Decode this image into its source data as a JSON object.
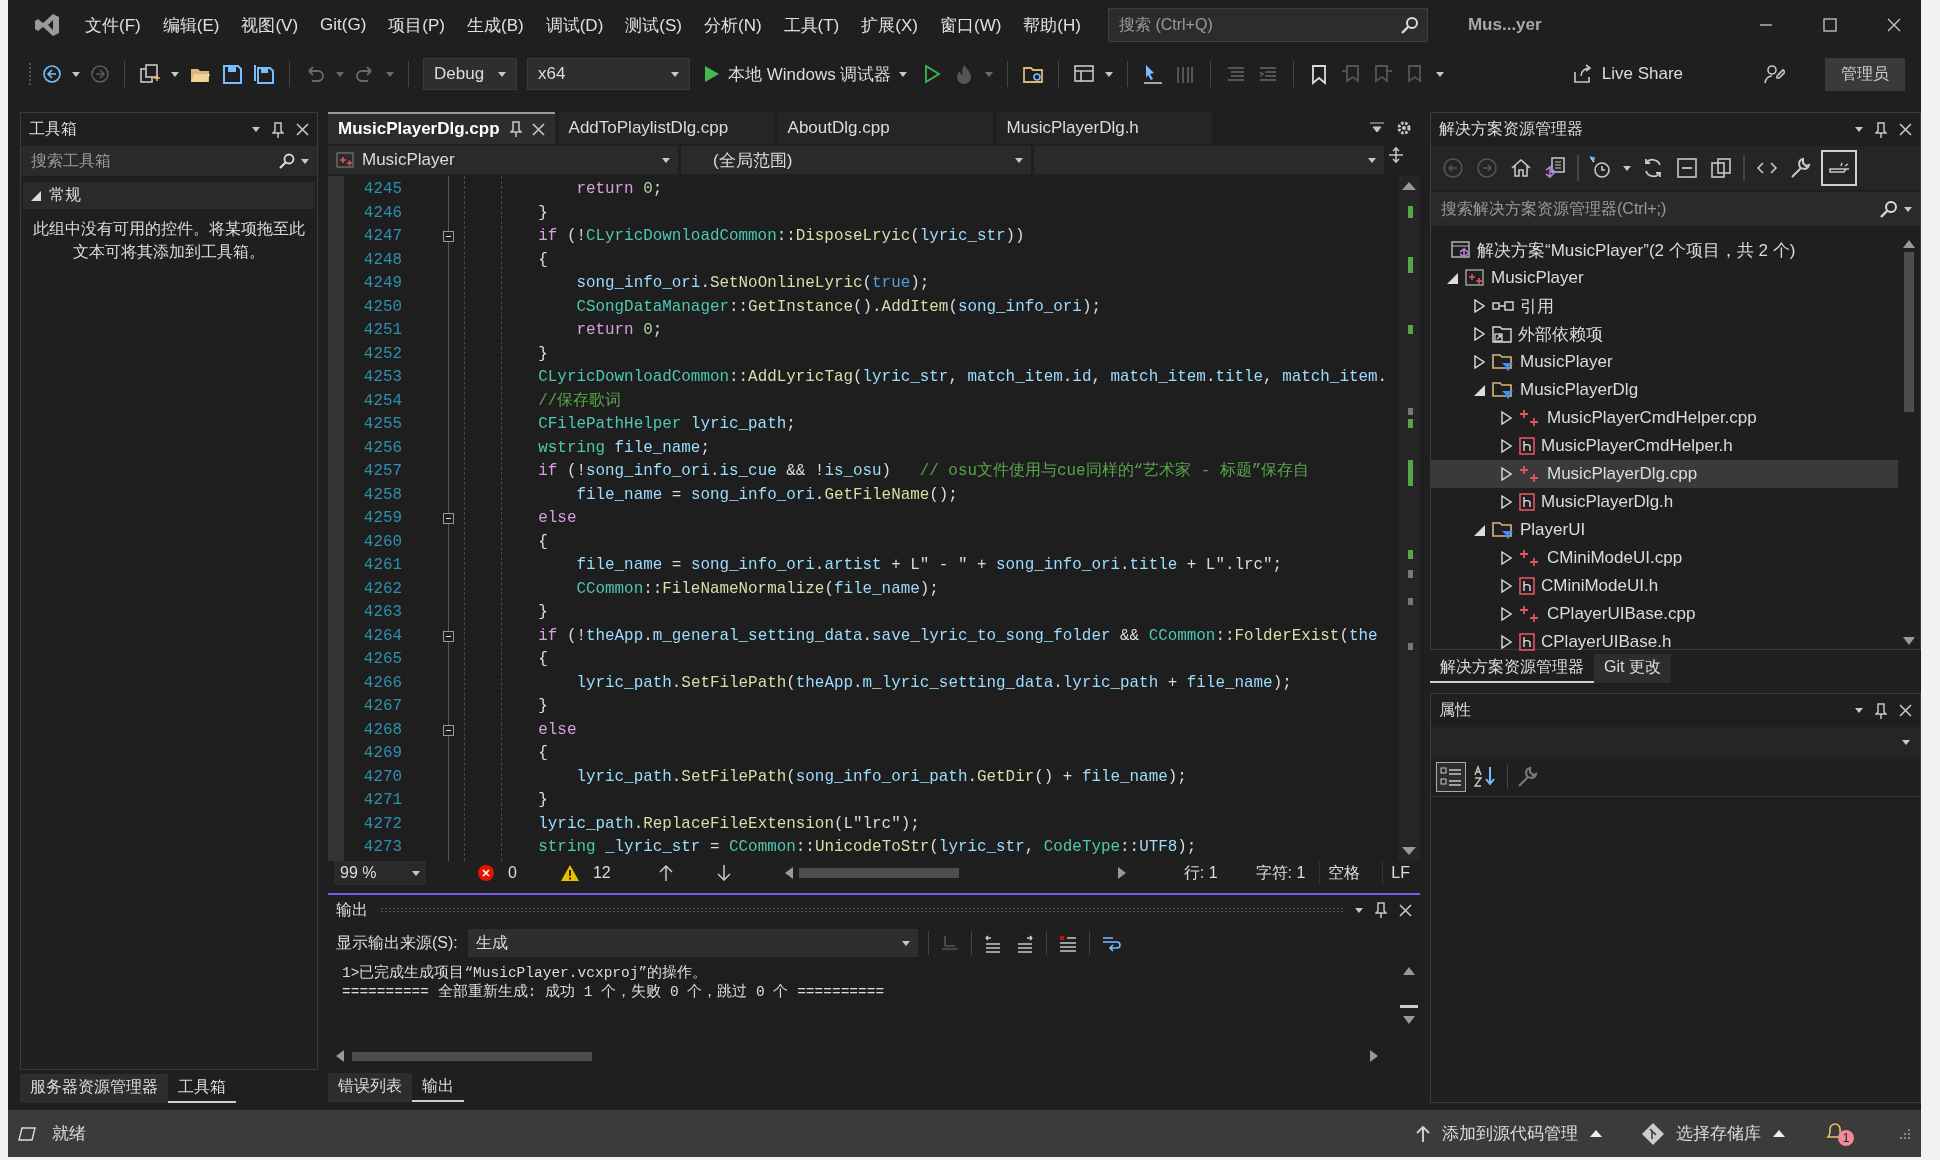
{
  "window": {
    "title": "Mus...yer"
  },
  "menu_bar": {
    "items": [
      "文件(F)",
      "编辑(E)",
      "视图(V)",
      "Git(G)",
      "项目(P)",
      "生成(B)",
      "调试(D)",
      "测试(S)",
      "分析(N)",
      "工具(T)",
      "扩展(X)",
      "窗口(W)",
      "帮助(H)"
    ]
  },
  "search": {
    "placeholder": "搜索 (Ctrl+Q)"
  },
  "toolbar": {
    "configuration": "Debug",
    "platform": "x64",
    "start_debugging": "本地 Windows 调试器",
    "live_share": "Live Share",
    "admin_badge": "管理员"
  },
  "toolbox": {
    "title": "工具箱",
    "search": {
      "placeholder": "搜索工具箱"
    },
    "group": {
      "label": "常规",
      "expanded": true
    },
    "message": "此组中没有可用的控件。将某项拖至此文本可将其添加到工具箱。"
  },
  "left_tabs": [
    {
      "label": "服务器资源管理器",
      "selected": false
    },
    {
      "label": "工具箱",
      "selected": true
    }
  ],
  "editor": {
    "tabs": [
      {
        "label": "MusicPlayerDlg.cpp",
        "selected": true
      },
      {
        "label": "AddToPlaylistDlg.cpp",
        "selected": false
      },
      {
        "label": "AboutDlg.cpp",
        "selected": false
      },
      {
        "label": "MusicPlayerDlg.h",
        "selected": false
      }
    ],
    "navigation": {
      "project": "MusicPlayer",
      "scope": "(全局范围)"
    },
    "lines": [
      {
        "number": "4245",
        "fold": false,
        "tokens": [
          {
            "kind": "kw",
            "text": "            return"
          },
          {
            "kind": "num",
            "text": " 0"
          },
          {
            "kind": "pl",
            "text": ";"
          }
        ]
      },
      {
        "number": "4246",
        "fold": false,
        "tokens": [
          {
            "kind": "pl",
            "text": "        }"
          }
        ]
      },
      {
        "number": "4247",
        "fold": true,
        "tokens": [
          {
            "kind": "kw",
            "text": "        if"
          },
          {
            "kind": "pl",
            "text": " (!"
          },
          {
            "kind": "ty",
            "text": "CLyricDownloadCommon"
          },
          {
            "kind": "pl",
            "text": "::"
          },
          {
            "kind": "fn",
            "text": "DisposeLryic"
          },
          {
            "kind": "pl",
            "text": "("
          },
          {
            "kind": "var",
            "text": "lyric_str"
          },
          {
            "kind": "pl",
            "text": "))"
          }
        ]
      },
      {
        "number": "4248",
        "fold": false,
        "tokens": [
          {
            "kind": "pl",
            "text": "        {"
          }
        ]
      },
      {
        "number": "4249",
        "fold": false,
        "tokens": [
          {
            "kind": "var",
            "text": "            song_info_ori"
          },
          {
            "kind": "pl",
            "text": "."
          },
          {
            "kind": "fn",
            "text": "SetNoOnlineLyric"
          },
          {
            "kind": "pl",
            "text": "("
          },
          {
            "kind": "bl",
            "text": "true"
          },
          {
            "kind": "pl",
            "text": ");"
          }
        ]
      },
      {
        "number": "4250",
        "fold": false,
        "tokens": [
          {
            "kind": "ty",
            "text": "            CSongDataManager"
          },
          {
            "kind": "pl",
            "text": "::"
          },
          {
            "kind": "fn",
            "text": "GetInstance"
          },
          {
            "kind": "pl",
            "text": "()."
          },
          {
            "kind": "fn",
            "text": "AddItem"
          },
          {
            "kind": "pl",
            "text": "("
          },
          {
            "kind": "var",
            "text": "song_info_ori"
          },
          {
            "kind": "pl",
            "text": ");"
          }
        ]
      },
      {
        "number": "4251",
        "fold": false,
        "tokens": [
          {
            "kind": "kw",
            "text": "            return"
          },
          {
            "kind": "num",
            "text": " 0"
          },
          {
            "kind": "pl",
            "text": ";"
          }
        ]
      },
      {
        "number": "4252",
        "fold": false,
        "tokens": [
          {
            "kind": "pl",
            "text": "        }"
          }
        ]
      },
      {
        "number": "4253",
        "fold": false,
        "tokens": [
          {
            "kind": "ty",
            "text": "        CLyricDownloadCommon"
          },
          {
            "kind": "pl",
            "text": "::"
          },
          {
            "kind": "fn",
            "text": "AddLyricTag"
          },
          {
            "kind": "pl",
            "text": "("
          },
          {
            "kind": "var",
            "text": "lyric_str"
          },
          {
            "kind": "pl",
            "text": ", "
          },
          {
            "kind": "var",
            "text": "match_item"
          },
          {
            "kind": "pl",
            "text": "."
          },
          {
            "kind": "var",
            "text": "id"
          },
          {
            "kind": "pl",
            "text": ", "
          },
          {
            "kind": "var",
            "text": "match_item"
          },
          {
            "kind": "pl",
            "text": "."
          },
          {
            "kind": "var",
            "text": "title"
          },
          {
            "kind": "pl",
            "text": ", "
          },
          {
            "kind": "var",
            "text": "match_item"
          },
          {
            "kind": "pl",
            "text": "."
          }
        ]
      },
      {
        "number": "4254",
        "fold": false,
        "tokens": [
          {
            "kind": "cm",
            "text": "        //保存歌词"
          }
        ]
      },
      {
        "number": "4255",
        "fold": false,
        "tokens": [
          {
            "kind": "ty",
            "text": "        CFilePathHelper"
          },
          {
            "kind": "var",
            "text": " lyric_path"
          },
          {
            "kind": "pl",
            "text": ";"
          }
        ]
      },
      {
        "number": "4256",
        "fold": false,
        "tokens": [
          {
            "kind": "ty",
            "text": "        wstring"
          },
          {
            "kind": "var",
            "text": " file_name"
          },
          {
            "kind": "pl",
            "text": ";"
          }
        ]
      },
      {
        "number": "4257",
        "fold": false,
        "tokens": [
          {
            "kind": "kw",
            "text": "        if"
          },
          {
            "kind": "pl",
            "text": " (!"
          },
          {
            "kind": "var",
            "text": "song_info_ori"
          },
          {
            "kind": "pl",
            "text": "."
          },
          {
            "kind": "var",
            "text": "is_cue"
          },
          {
            "kind": "pl",
            "text": " && !"
          },
          {
            "kind": "var",
            "text": "is_osu"
          },
          {
            "kind": "pl",
            "text": ")"
          },
          {
            "kind": "cm",
            "text": "   // osu文件使用与cue同样的“艺术家 - 标题”保存自"
          }
        ]
      },
      {
        "number": "4258",
        "fold": false,
        "tokens": [
          {
            "kind": "var",
            "text": "            file_name"
          },
          {
            "kind": "pl",
            "text": " = "
          },
          {
            "kind": "var",
            "text": "song_info_ori"
          },
          {
            "kind": "pl",
            "text": "."
          },
          {
            "kind": "fn",
            "text": "GetFileName"
          },
          {
            "kind": "pl",
            "text": "();"
          }
        ]
      },
      {
        "number": "4259",
        "fold": true,
        "tokens": [
          {
            "kind": "kw",
            "text": "        else"
          }
        ]
      },
      {
        "number": "4260",
        "fold": false,
        "tokens": [
          {
            "kind": "pl",
            "text": "        {"
          }
        ]
      },
      {
        "number": "4261",
        "fold": false,
        "tokens": [
          {
            "kind": "var",
            "text": "            file_name"
          },
          {
            "kind": "pl",
            "text": " = "
          },
          {
            "kind": "var",
            "text": "song_info_ori"
          },
          {
            "kind": "pl",
            "text": "."
          },
          {
            "kind": "var",
            "text": "artist"
          },
          {
            "kind": "pl",
            "text": " + L\" - \" + "
          },
          {
            "kind": "var",
            "text": "song_info_ori"
          },
          {
            "kind": "pl",
            "text": "."
          },
          {
            "kind": "var",
            "text": "title"
          },
          {
            "kind": "pl",
            "text": " + L\".lrc\";"
          }
        ]
      },
      {
        "number": "4262",
        "fold": false,
        "tokens": [
          {
            "kind": "ty",
            "text": "            CCommon"
          },
          {
            "kind": "pl",
            "text": "::"
          },
          {
            "kind": "fn",
            "text": "FileNameNormalize"
          },
          {
            "kind": "pl",
            "text": "("
          },
          {
            "kind": "var",
            "text": "file_name"
          },
          {
            "kind": "pl",
            "text": ");"
          }
        ]
      },
      {
        "number": "4263",
        "fold": false,
        "tokens": [
          {
            "kind": "pl",
            "text": "        }"
          }
        ]
      },
      {
        "number": "4264",
        "fold": true,
        "tokens": [
          {
            "kind": "kw",
            "text": "        if"
          },
          {
            "kind": "pl",
            "text": " (!"
          },
          {
            "kind": "var",
            "text": "theApp"
          },
          {
            "kind": "pl",
            "text": "."
          },
          {
            "kind": "var",
            "text": "m_general_setting_data"
          },
          {
            "kind": "pl",
            "text": "."
          },
          {
            "kind": "var",
            "text": "save_lyric_to_song_folder"
          },
          {
            "kind": "pl",
            "text": " && "
          },
          {
            "kind": "ty",
            "text": "CCommon"
          },
          {
            "kind": "pl",
            "text": "::"
          },
          {
            "kind": "fn",
            "text": "FolderExist"
          },
          {
            "kind": "pl",
            "text": "("
          },
          {
            "kind": "var",
            "text": "the"
          }
        ]
      },
      {
        "number": "4265",
        "fold": false,
        "tokens": [
          {
            "kind": "pl",
            "text": "        {"
          }
        ]
      },
      {
        "number": "4266",
        "fold": false,
        "tokens": [
          {
            "kind": "var",
            "text": "            lyric_path"
          },
          {
            "kind": "pl",
            "text": "."
          },
          {
            "kind": "fn",
            "text": "SetFilePath"
          },
          {
            "kind": "pl",
            "text": "("
          },
          {
            "kind": "var",
            "text": "theApp"
          },
          {
            "kind": "pl",
            "text": "."
          },
          {
            "kind": "var",
            "text": "m_lyric_setting_data"
          },
          {
            "kind": "pl",
            "text": "."
          },
          {
            "kind": "var",
            "text": "lyric_path"
          },
          {
            "kind": "pl",
            "text": " + "
          },
          {
            "kind": "var",
            "text": "file_name"
          },
          {
            "kind": "pl",
            "text": ");"
          }
        ]
      },
      {
        "number": "4267",
        "fold": false,
        "tokens": [
          {
            "kind": "pl",
            "text": "        }"
          }
        ]
      },
      {
        "number": "4268",
        "fold": true,
        "tokens": [
          {
            "kind": "kw",
            "text": "        else"
          }
        ]
      },
      {
        "number": "4269",
        "fold": false,
        "tokens": [
          {
            "kind": "pl",
            "text": "        {"
          }
        ]
      },
      {
        "number": "4270",
        "fold": false,
        "tokens": [
          {
            "kind": "var",
            "text": "            lyric_path"
          },
          {
            "kind": "pl",
            "text": "."
          },
          {
            "kind": "fn",
            "text": "SetFilePath"
          },
          {
            "kind": "pl",
            "text": "("
          },
          {
            "kind": "var",
            "text": "song_info_ori_path"
          },
          {
            "kind": "pl",
            "text": "."
          },
          {
            "kind": "fn",
            "text": "GetDir"
          },
          {
            "kind": "pl",
            "text": "() + "
          },
          {
            "kind": "var",
            "text": "file_name"
          },
          {
            "kind": "pl",
            "text": ");"
          }
        ]
      },
      {
        "number": "4271",
        "fold": false,
        "tokens": [
          {
            "kind": "pl",
            "text": "        }"
          }
        ]
      },
      {
        "number": "4272",
        "fold": false,
        "tokens": [
          {
            "kind": "var",
            "text": "        lyric_path"
          },
          {
            "kind": "pl",
            "text": "."
          },
          {
            "kind": "fn",
            "text": "ReplaceFileExtension"
          },
          {
            "kind": "pl",
            "text": "(L\"lrc\");"
          }
        ]
      },
      {
        "number": "4273",
        "fold": false,
        "tokens": [
          {
            "kind": "ty",
            "text": "        string"
          },
          {
            "kind": "var",
            "text": " _lyric_str"
          },
          {
            "kind": "pl",
            "text": " = "
          },
          {
            "kind": "ty",
            "text": "CCommon"
          },
          {
            "kind": "pl",
            "text": "::"
          },
          {
            "kind": "fn",
            "text": "UnicodeToStr"
          },
          {
            "kind": "pl",
            "text": "("
          },
          {
            "kind": "var",
            "text": "lyric_str"
          },
          {
            "kind": "pl",
            "text": ", "
          },
          {
            "kind": "ty",
            "text": "CodeType"
          },
          {
            "kind": "pl",
            "text": "::"
          },
          {
            "kind": "var",
            "text": "UTF8"
          },
          {
            "kind": "pl",
            "text": ");"
          }
        ]
      }
    ],
    "status": {
      "zoom": "99 %",
      "errors": "0",
      "warnings": "12",
      "line": "行: 1",
      "column": "字符: 1",
      "indentation": "空格",
      "line_endings": "LF"
    }
  },
  "output": {
    "title": "输出",
    "source_label": "显示输出来源(S):",
    "source": "生成",
    "lines": [
      "1>已完成生成项目“MusicPlayer.vcxproj”的操作。",
      "========== 全部重新生成: 成功 1 个，失败 0 个，跳过 0 个 =========="
    ]
  },
  "bottom_tabs": [
    {
      "label": "错误列表",
      "selected": false
    },
    {
      "label": "输出",
      "selected": true
    }
  ],
  "solution_explorer": {
    "title": "解决方案资源管理器",
    "search": {
      "placeholder": "搜索解决方案资源管理器(Ctrl+;)"
    },
    "tree": [
      {
        "kind": "solution",
        "label": "解决方案“MusicPlayer”(2 个项目，共 2 个)",
        "selected": false,
        "children": [
          {
            "kind": "project",
            "label": "MusicPlayer",
            "expanded": true,
            "selected": false,
            "children": [
              {
                "kind": "references",
                "label": "引用",
                "expanded": false,
                "selected": false
              },
              {
                "kind": "external",
                "label": "外部依赖项",
                "expanded": false,
                "selected": false
              },
              {
                "kind": "filter",
                "label": "MusicPlayer",
                "expanded": false,
                "selected": false
              },
              {
                "kind": "filter",
                "label": "MusicPlayerDlg",
                "expanded": true,
                "selected": false,
                "children": [
                  {
                    "kind": "cpp",
                    "label": "MusicPlayerCmdHelper.cpp",
                    "expanded": false,
                    "selected": false
                  },
                  {
                    "kind": "h",
                    "label": "MusicPlayerCmdHelper.h",
                    "expanded": false,
                    "selected": false
                  },
                  {
                    "kind": "cpp",
                    "label": "MusicPlayerDlg.cpp",
                    "expanded": false,
                    "selected": true
                  },
                  {
                    "kind": "h",
                    "label": "MusicPlayerDlg.h",
                    "expanded": false,
                    "selected": false
                  }
                ]
              },
              {
                "kind": "filter",
                "label": "PlayerUI",
                "expanded": true,
                "selected": false,
                "children": [
                  {
                    "kind": "cpp",
                    "label": "CMiniModeUI.cpp",
                    "expanded": false,
                    "selected": false
                  },
                  {
                    "kind": "h",
                    "label": "CMiniModeUI.h",
                    "expanded": false,
                    "selected": false
                  },
                  {
                    "kind": "cpp",
                    "label": "CPlayerUIBase.cpp",
                    "expanded": false,
                    "selected": false
                  },
                  {
                    "kind": "h",
                    "label": "CPlayerUIBase.h",
                    "expanded": false,
                    "selected": false
                  }
                ]
              }
            ]
          }
        ]
      }
    ]
  },
  "right_tabs": [
    {
      "label": "解决方案资源管理器",
      "selected": true
    },
    {
      "label": "Git 更改",
      "selected": false
    }
  ],
  "properties": {
    "title": "属性"
  },
  "status_bar": {
    "state": "就绪",
    "source_control": "添加到源代码管理",
    "repository": "选择存储库",
    "notifications": "1"
  }
}
